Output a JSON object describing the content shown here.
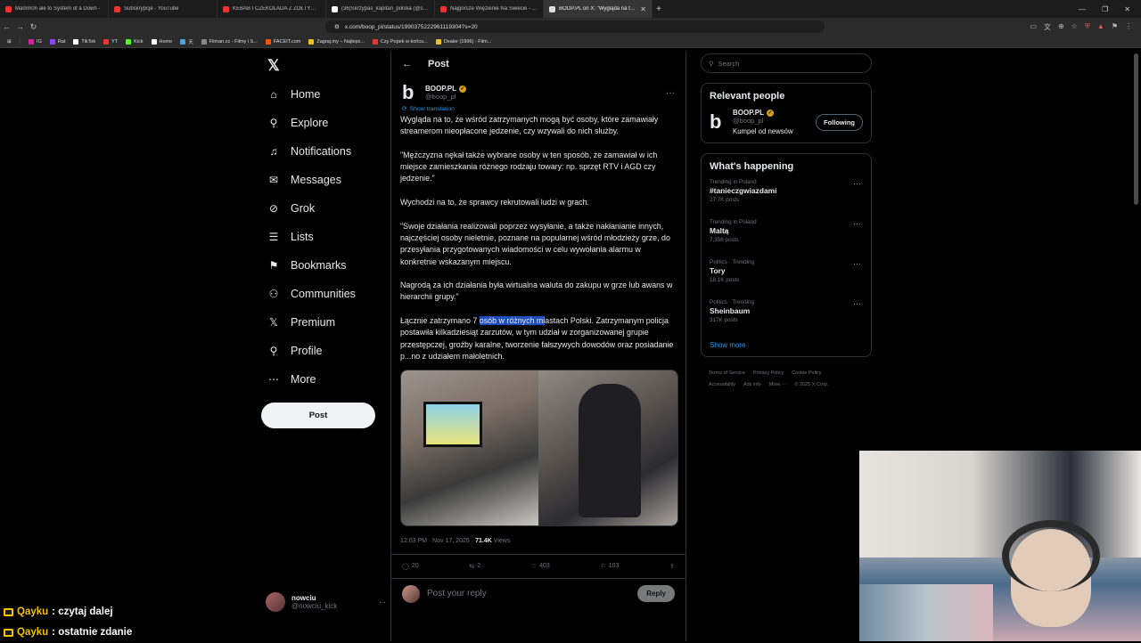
{
  "browser": {
    "tabs": [
      {
        "title": "Mamm0n ale to System of a Down -",
        "color": "#e33"
      },
      {
        "title": "Subskrypcje - YouTube",
        "color": "#e33"
      },
      {
        "title": "KEBAB I CZEKOLADA Z ŻÓŁTYM SER",
        "color": "#e33"
      },
      {
        "title": "(36)Skrzypas_kapitan_polska (@skrzy",
        "color": "#e33"
      },
      {
        "title": "Najgorsze Więzienie Na Świecie - Yo",
        "color": "#e33"
      },
      {
        "title": "BOOP.PL on X: \"Wygląda na to, ż",
        "color": "#ddd"
      }
    ],
    "url": "x.com/boop_pl/status/1990375222961119304?s=20",
    "bookmarks": [
      {
        "label": "IG",
        "color": "#d6249f"
      },
      {
        "label": "Rat",
        "color": "#9147ff"
      },
      {
        "label": "TikTok",
        "color": "#ffffff"
      },
      {
        "label": "YT",
        "color": "#e33"
      },
      {
        "label": "Kick",
        "color": "#53fc18"
      },
      {
        "label": "Home",
        "color": "#ffffff"
      },
      {
        "label": "天",
        "color": "#4aa3df"
      },
      {
        "label": "Filman.cc - Filmy i S...",
        "color": "#888888"
      },
      {
        "label": "FACEIT.com",
        "color": "#ff5500"
      },
      {
        "label": "Zagraj.my – Najleps...",
        "color": "#f0c020"
      },
      {
        "label": "Czy Popek w końcu...",
        "color": "#e33"
      },
      {
        "label": "Dealer (1996) - Film...",
        "color": "#f0c020"
      }
    ]
  },
  "nav": {
    "items": [
      {
        "label": "Home",
        "icon": "home-icon",
        "glyph": "⌂"
      },
      {
        "label": "Explore",
        "icon": "search-icon",
        "glyph": "⚲"
      },
      {
        "label": "Notifications",
        "icon": "bell-icon",
        "glyph": "♫"
      },
      {
        "label": "Messages",
        "icon": "mail-icon",
        "glyph": "✉"
      },
      {
        "label": "Grok",
        "icon": "grok-icon",
        "glyph": "⊘"
      },
      {
        "label": "Lists",
        "icon": "list-icon",
        "glyph": "☰"
      },
      {
        "label": "Bookmarks",
        "icon": "bookmark-icon",
        "glyph": "⚑"
      },
      {
        "label": "Communities",
        "icon": "people-icon",
        "glyph": "⚇"
      },
      {
        "label": "Premium",
        "icon": "x-icon",
        "glyph": "𝕏"
      },
      {
        "label": "Profile",
        "icon": "person-icon",
        "glyph": "⚲"
      },
      {
        "label": "More",
        "icon": "more-circle-icon",
        "glyph": "⋯"
      }
    ],
    "post_label": "Post",
    "account": {
      "name": "nowciu",
      "handle": "@nowciu_kick"
    }
  },
  "post": {
    "header": "Post",
    "author": "BOOP.PL",
    "handle": "@boop_pl",
    "show_translation": "Show translation",
    "paragraphs": [
      "Wygląda na to, że wśród zatrzymanych mogą być osoby, które zamawiały streamerom nieopłacone jedzenie, czy wzywali do nich służby.",
      "\"Mężczyzna nękał także wybrane osoby w ten sposób, że zamawiał w ich miejsce zamieszkania różnego rodzaju towary: np. sprzęt RTV i AGD czy jedzenie.\"",
      "Wychodzi na to, że sprawcy rekrutowali ludzi w grach.",
      "\"Swoje działania realizowali poprzez wysyłanie, a także nakłanianie innych, najczęściej osoby nieletnie, poznane na popularnej wśród młodzieży grze, do przesyłania przygotowanych wiadomości w celu wywołania alarmu w konkretnie wskazanym miejscu.",
      "Nagrodą za ich działania była wirtualna waluta do zakupu w grze lub awans w hierarchii grupy.\""
    ],
    "last_before": "Łącznie zatrzymano 7 ",
    "last_highlight": "osób w różnych mi",
    "last_after": "astach Polski. Zatrzymanym policja postawiła kilkadziesiąt zarzutów, w tym udział w zorganizowanej grupie przestępczej, groźby karalne, tworzenie fałszywych dowodów oraz posiadanie p...no z udziałem małoletnich.",
    "time": "12:03 PM · Nov 17, 2025 · ",
    "views": "71.4K",
    "views_label": "Views",
    "replies": "20",
    "reposts": "2",
    "likes": "403",
    "bookmarks": "103",
    "reply_placeholder": "Post your reply",
    "reply_button": "Reply"
  },
  "sidebar": {
    "search_placeholder": "Search",
    "relevant_title": "Relevant people",
    "person": {
      "name": "BOOP.PL",
      "handle": "@boop_pl",
      "bio": "Kumpel od newsów",
      "button": "Following"
    },
    "happening_title": "What's happening",
    "trends": [
      {
        "context": "Trending in Poland",
        "title": "#tanieczgwiazdami",
        "count": "27.7K posts"
      },
      {
        "context": "Trending in Poland",
        "title": "Maltą",
        "count": "7,356 posts"
      },
      {
        "context": "Politics · Trending",
        "title": "Tory",
        "count": "18.1K posts"
      },
      {
        "context": "Politics · Trending",
        "title": "Sheinbaum",
        "count": "317K posts"
      }
    ],
    "show_more": "Show more",
    "footer": [
      "Terms of Service",
      "Privacy Policy",
      "Cookie Policy",
      "Accessibility",
      "Ads info",
      "More ···",
      "© 2025 X Corp."
    ]
  },
  "chat": [
    {
      "user": "Qayku",
      "message": ": czytaj dalej"
    },
    {
      "user": "Qayku",
      "message": ": ostatnie zdanie"
    }
  ],
  "colors": {
    "accent": "#1d9bf0",
    "verified": "#d4a017",
    "chat_user": "#f2c300",
    "highlight": "#1f4fbf"
  }
}
